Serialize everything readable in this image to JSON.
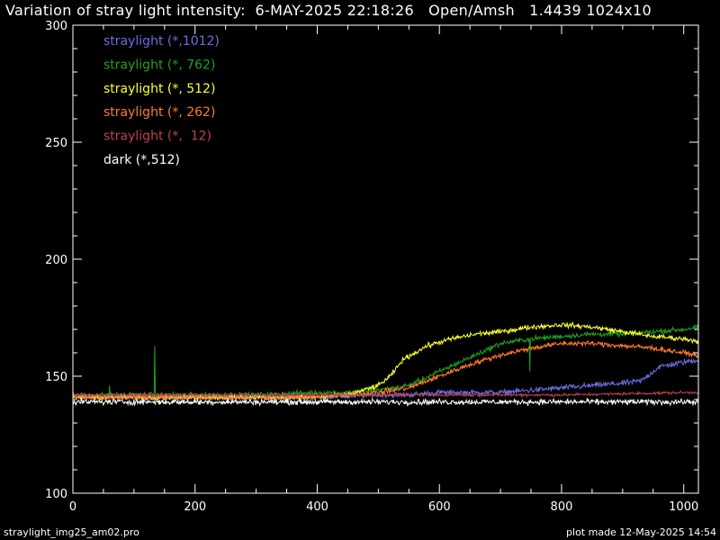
{
  "title": "Variation of stray light intensity:  6-MAY-2025 22:18:26   Open/Amsh   1.4439 1024x10",
  "footer_left": "straylight_img25_am02.pro",
  "footer_right": "plot made 12-May-2025 14:54",
  "chart_data": {
    "type": "line",
    "title": "Variation of stray light intensity:  6-MAY-2025 22:18:26   Open/Amsh   1.4439 1024x10",
    "xlabel": "",
    "ylabel": "",
    "xlim": [
      0,
      1024
    ],
    "ylim": [
      100,
      300
    ],
    "xticks": [
      0,
      200,
      400,
      600,
      800,
      1000
    ],
    "yticks": [
      100,
      150,
      200,
      250,
      300
    ],
    "grid": false,
    "legend_position": "top-left",
    "series": [
      {
        "name": "straylight (*,1012)",
        "color": "#6a6ee0",
        "x": [
          0,
          100,
          200,
          300,
          400,
          500,
          550,
          600,
          650,
          700,
          750,
          800,
          850,
          900,
          930,
          960,
          1000,
          1024
        ],
        "y": [
          141,
          141,
          141,
          141,
          141,
          142,
          142,
          143,
          143,
          143,
          144,
          145,
          146,
          147,
          148,
          154,
          156,
          157
        ],
        "noise": 1.8
      },
      {
        "name": "straylight (*, 762)",
        "color": "#20a020",
        "x": [
          0,
          100,
          200,
          300,
          400,
          450,
          500,
          550,
          600,
          650,
          700,
          750,
          800,
          850,
          900,
          950,
          1000,
          1024
        ],
        "y": [
          142,
          142,
          142,
          142,
          143,
          143,
          144,
          146,
          152,
          158,
          164,
          166,
          167,
          168,
          168,
          169,
          170,
          171
        ],
        "noise": 1.6,
        "spikes": [
          {
            "x": 60,
            "y": 146
          },
          {
            "x": 134,
            "y": 163
          },
          {
            "x": 748,
            "y": 152
          }
        ]
      },
      {
        "name": "straylight (*, 512)",
        "color": "#ffff30",
        "x": [
          0,
          100,
          200,
          300,
          400,
          450,
          500,
          520,
          540,
          580,
          620,
          660,
          700,
          750,
          800,
          850,
          900,
          950,
          1000,
          1024
        ],
        "y": [
          141,
          141,
          141,
          141,
          141,
          142,
          146,
          150,
          157,
          163,
          166,
          168,
          169,
          171,
          172,
          171,
          169,
          167,
          166,
          165
        ],
        "noise": 1.6
      },
      {
        "name": "straylight (*, 262)",
        "color": "#ff7a30",
        "x": [
          0,
          100,
          200,
          300,
          400,
          500,
          550,
          600,
          650,
          700,
          750,
          800,
          850,
          900,
          950,
          1000,
          1024
        ],
        "y": [
          141,
          141,
          141,
          141,
          141,
          143,
          145,
          150,
          155,
          159,
          162,
          164,
          164,
          163,
          162,
          160,
          159
        ],
        "noise": 1.6
      },
      {
        "name": "straylight (*,  12)",
        "color": "#c04050",
        "x": [
          0,
          200,
          400,
          600,
          800,
          1000,
          1024
        ],
        "y": [
          142,
          142,
          142,
          142,
          142,
          143,
          143
        ],
        "noise": 0.9
      },
      {
        "name": "dark (*,512)",
        "color": "#ffffff",
        "x": [
          0,
          200,
          400,
          600,
          800,
          1000,
          1024
        ],
        "y": [
          139,
          139,
          139,
          139,
          139,
          139,
          139
        ],
        "noise": 1.8
      }
    ]
  }
}
